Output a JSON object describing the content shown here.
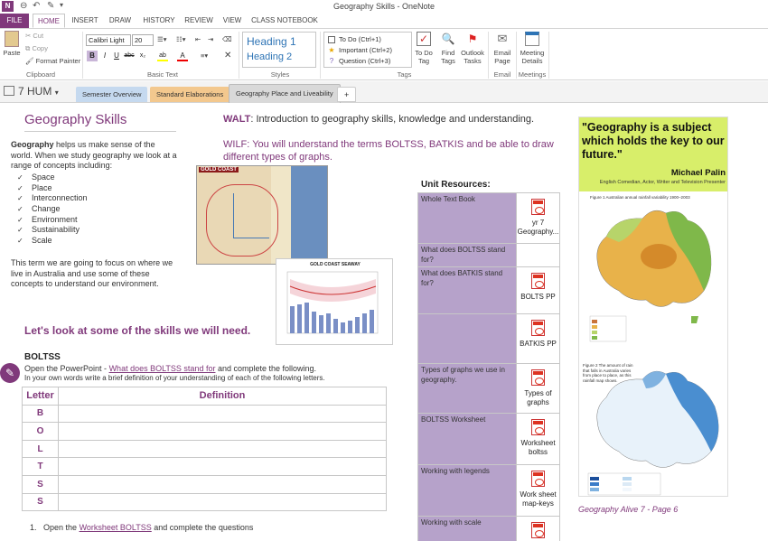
{
  "window": {
    "title": "Geography Skills - OneNote",
    "app_logo": "N"
  },
  "ribbon_tabs": [
    "FILE",
    "HOME",
    "INSERT",
    "DRAW",
    "HISTORY",
    "REVIEW",
    "VIEW",
    "CLASS NOTEBOOK"
  ],
  "clipboard": {
    "paste": "Paste",
    "cut": "Cut",
    "copy": "Copy",
    "format_painter": "Format Painter",
    "label": "Clipboard"
  },
  "basic_text": {
    "font": "Calibri Light",
    "size": "20",
    "label": "Basic Text",
    "bold": "B",
    "italic": "I",
    "underline": "U",
    "strike": "abc",
    "sub": "x₂",
    "highlight": "ab",
    "font_color": "A"
  },
  "styles": {
    "h1": "Heading 1",
    "h2": "Heading 2",
    "label": "Styles"
  },
  "tags": {
    "items": [
      "To Do (Ctrl+1)",
      "Important (Ctrl+2)",
      "Question (Ctrl+3)"
    ],
    "todo_tag": "To Do Tag",
    "find_tags": "Find Tags",
    "outlook_tasks": "Outlook Tasks",
    "label": "Tags"
  },
  "email": {
    "button": "Email Page",
    "label": "Email"
  },
  "meetings": {
    "button": "Meeting Details",
    "label": "Meetings"
  },
  "notebook": {
    "name": "7 HUM"
  },
  "sections": [
    "Semester Overview",
    "Standard Elaborations",
    "Geography Place and Liveability",
    "+"
  ],
  "page": {
    "title": "Geography Skills",
    "intro_bold": "Geography",
    "intro": " helps us make sense of the world. When we study geography we look at a range of concepts including:",
    "concepts": [
      "Space",
      "Place",
      "Interconnection",
      "Change",
      "Environment",
      "Sustainability",
      "Scale"
    ],
    "focus": "This term we are going to focus on where we live in Australia and use some of these concepts to understand our environment.",
    "walt_label": "WALT",
    "walt": ": Introduction to geography skills, knowledge and understanding.",
    "wilf_label": "WILF",
    "wilf": ": You will understand the terms BOLTSS, BATKIS and be able to draw different types of graphs.",
    "skills_heading": "Let's look at some of the skills we will need.",
    "boltss_heading": "BOLTSS",
    "open_pp_pre": "Open the PowerPoint - ",
    "open_pp_link": "What does BOLTSS stand for",
    "open_pp_post": " and complete the following.",
    "own_words": "In your own words write a brief definition of your understanding of each of the following letters.",
    "table_headers": [
      "Letter",
      "Definition"
    ],
    "letters": [
      "B",
      "O",
      "L",
      "T",
      "S",
      "S"
    ],
    "list_num": "1.",
    "list_pre": "Open the ",
    "list_link": "Worksheet BOLTSS",
    "list_post": " and complete the questions"
  },
  "map_image": {
    "label": "GOLD COAST"
  },
  "graph_image": {
    "label": "GOLD COAST SEAWAY"
  },
  "resources": {
    "heading": "Unit Resources:",
    "rows": [
      {
        "label": "Whole Text Book",
        "file": "yr 7 Geography..."
      },
      {
        "label": "What does BOLTSS stand for?",
        "file": ""
      },
      {
        "label": "What does BATKIS stand for?",
        "file": "BOLTS PP"
      },
      {
        "label": "",
        "file": "BATKIS PP"
      },
      {
        "label": "Types of graphs we use in geography.",
        "file": "Types of graphs"
      },
      {
        "label": "BOLTSS Worksheet",
        "file": "Worksheet boltss"
      },
      {
        "label": "Working with legends",
        "file": "Work sheet map-keys"
      },
      {
        "label": "Working with scale",
        "file": ""
      }
    ]
  },
  "quote": {
    "text": "\"Geography is a subject which holds the key to our future.\"",
    "author": "Michael Palin",
    "byline": "English Comedian, Actor, Writer and Television Presenter"
  },
  "figure1": "Figure 1 Australian annual rainfall variability 1900–2003",
  "figure2": "Figure 2 The amount of rain that falls in Australia varies from place to place, as this rainfall map shows.",
  "caption": "Geography Alive 7 - Page 6"
}
